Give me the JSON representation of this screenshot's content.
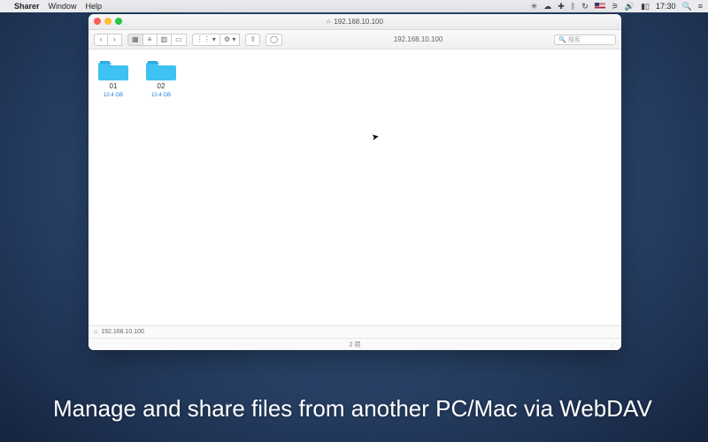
{
  "menubar": {
    "app_name": "Sharer",
    "items": [
      "Window",
      "Help"
    ],
    "time": "17:30"
  },
  "finder": {
    "title": "192.168.10.100",
    "toolbar": {
      "path": "192.168.10.100",
      "search_placeholder": "搜索"
    },
    "folders": [
      {
        "name": "01",
        "sub": "10.4 GB"
      },
      {
        "name": "02",
        "sub": "10.4 GB"
      }
    ],
    "pathbar": "192.168.10.100",
    "statusbar": {
      "items": "2 项"
    }
  },
  "caption": "Manage and share files from another PC/Mac via WebDAV"
}
